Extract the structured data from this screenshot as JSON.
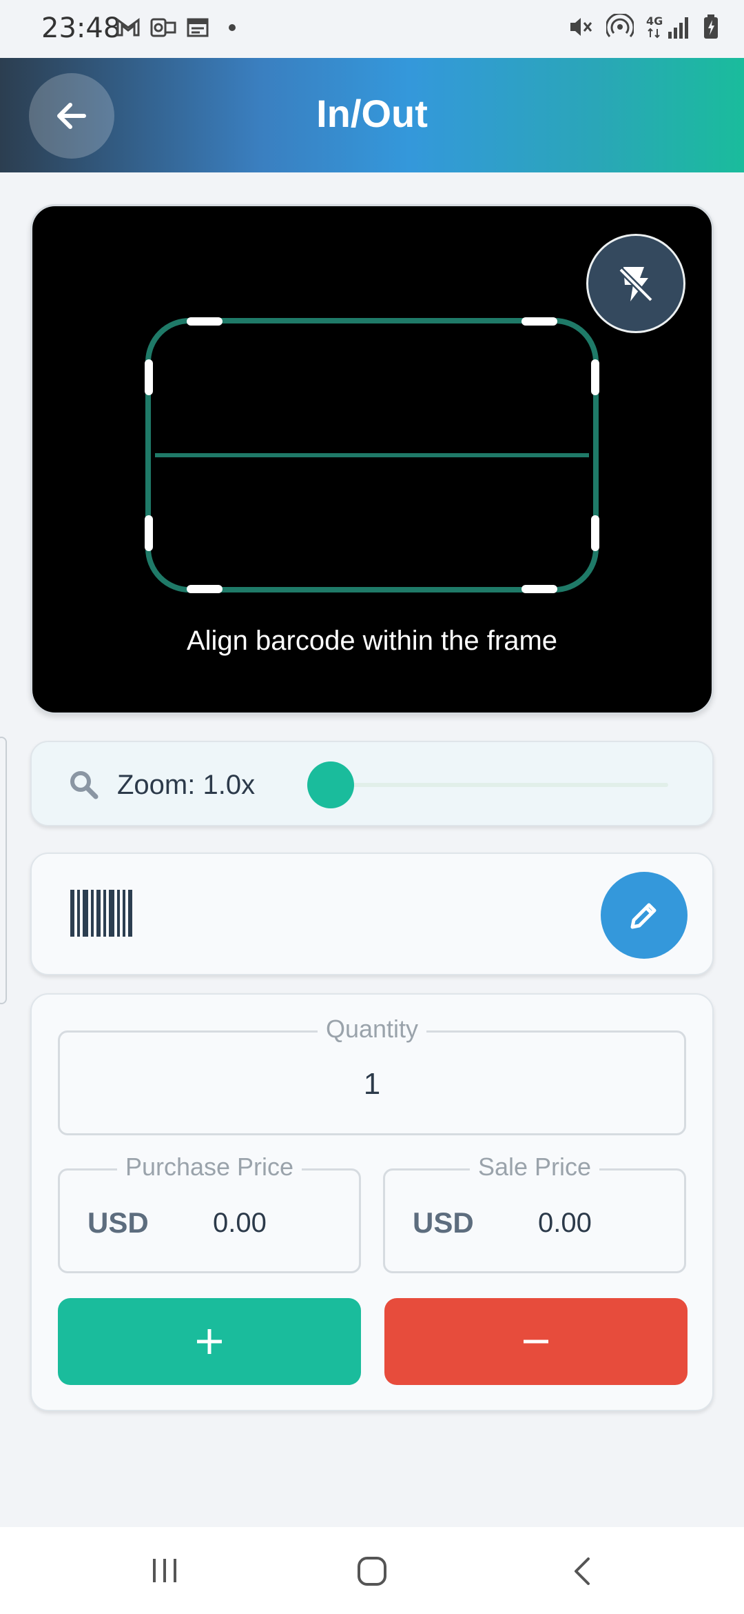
{
  "status_bar": {
    "time": "23:48",
    "left_icons": [
      "gmail-icon",
      "outlook-icon",
      "calendar-icon"
    ],
    "right_icons": [
      "mute-icon",
      "hotspot-icon",
      "4g-signal-icon",
      "battery-icon"
    ]
  },
  "header": {
    "title": "In/Out",
    "back_icon": "arrow-left-icon"
  },
  "camera": {
    "flash_icon": "flash-off-icon",
    "hint": "Align barcode within the frame",
    "frame_color": "#1f7a68"
  },
  "zoom": {
    "label": "Zoom: 1.0x",
    "value": 1.0,
    "min": 1.0,
    "max": 5.0,
    "icon": "search-icon"
  },
  "barcode": {
    "icon": "barcode-icon",
    "edit_icon": "pencil-icon"
  },
  "form": {
    "quantity_label": "Quantity",
    "quantity_value": "1",
    "purchase_price_label": "Purchase Price",
    "purchase_currency": "USD",
    "purchase_value": "0.00",
    "sale_price_label": "Sale Price",
    "sale_currency": "USD",
    "sale_value": "0.00",
    "add_icon": "plus-icon",
    "remove_icon": "minus-icon"
  },
  "colors": {
    "accent_green": "#1abc9c",
    "accent_red": "#e74c3c",
    "accent_blue": "#3498db",
    "dark_slate": "#2c3e50"
  },
  "nav_bar": {
    "icons": [
      "recents-icon",
      "home-icon",
      "back-icon"
    ]
  }
}
